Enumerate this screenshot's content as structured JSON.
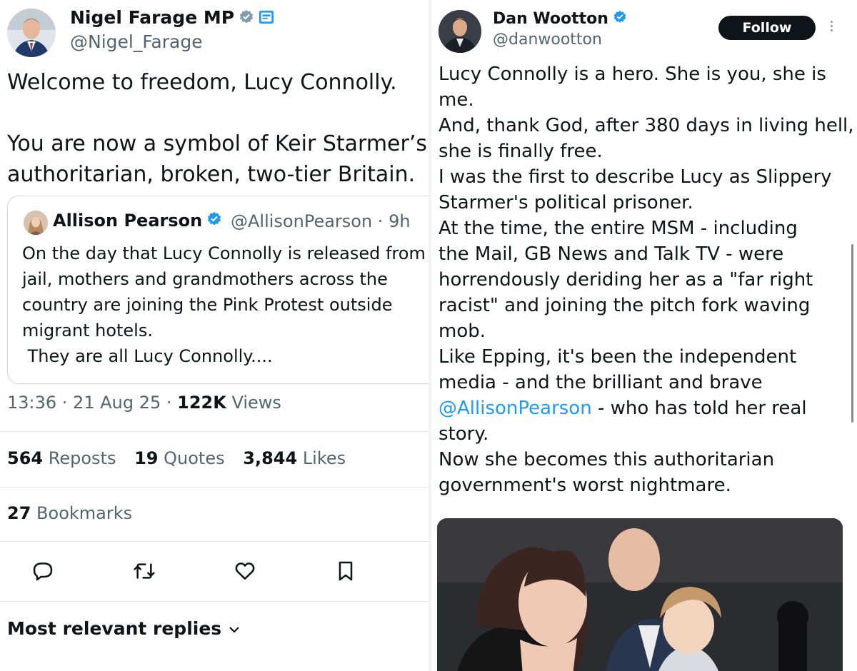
{
  "left_tweet": {
    "author_name": "Nigel Farage MP",
    "author_handle": "@Nigel_Farage",
    "text_lines": [
      "Welcome to freedom, Lucy Connolly.",
      "You are now a symbol of Keir Starmer’s",
      "authoritarian, broken, two-tier Britain."
    ],
    "quoted": {
      "author_name": "Allison Pearson",
      "author_handle_time": "@AllisonPearson · 9h",
      "text_lines": [
        "On the day that Lucy Connolly is released from",
        "jail, mothers and grandmothers across the",
        "country are joining the Pink Protest outside",
        "migrant hotels.",
        " They are all Lucy Connolly...."
      ]
    },
    "meta": {
      "time": "13:36 · 21 Aug 25 · ",
      "views_count": "122K",
      "views_label": " Views"
    },
    "stats": {
      "reposts_count": "564",
      "reposts_label": "Reposts",
      "quotes_count": "19",
      "quotes_label": "Quotes",
      "likes_count": "3,844",
      "likes_label": "Likes",
      "bookmarks_count": "27",
      "bookmarks_label": "Bookmarks"
    },
    "actions": [
      "reply-icon",
      "repost-icon",
      "like-icon",
      "bookmark-icon"
    ],
    "replies_sort": "Most relevant replies"
  },
  "right_tweet": {
    "author_name": "Dan Wootton",
    "author_handle": "@danwootton",
    "follow_label": "Follow",
    "text_lines": [
      "Lucy Connolly is a hero. She is you, she is",
      "me.",
      "And, thank God, after 380 days in living hell,",
      "she is finally free.",
      "I was the first to describe Lucy as Slippery",
      "Starmer's political prisoner.",
      "At the time, the entire MSM - including",
      "the Mail, GB News and Talk TV - were",
      "horrendously deriding her as a \"far right",
      "racist\" and joining the pitch fork waving",
      "mob.",
      "Like Epping, it's been the independent",
      "media - and the brilliant and brave",
      "",
      "story.",
      "Now she becomes this authoritarian",
      "government's worst nightmare."
    ],
    "mention": "@AllisonPearson",
    "mention_suffix": " - who has told her real"
  },
  "colors": {
    "accent": "#1d9bf0",
    "text": "#0f1419",
    "secondary": "#536471",
    "verified_gray": "#829aab"
  }
}
